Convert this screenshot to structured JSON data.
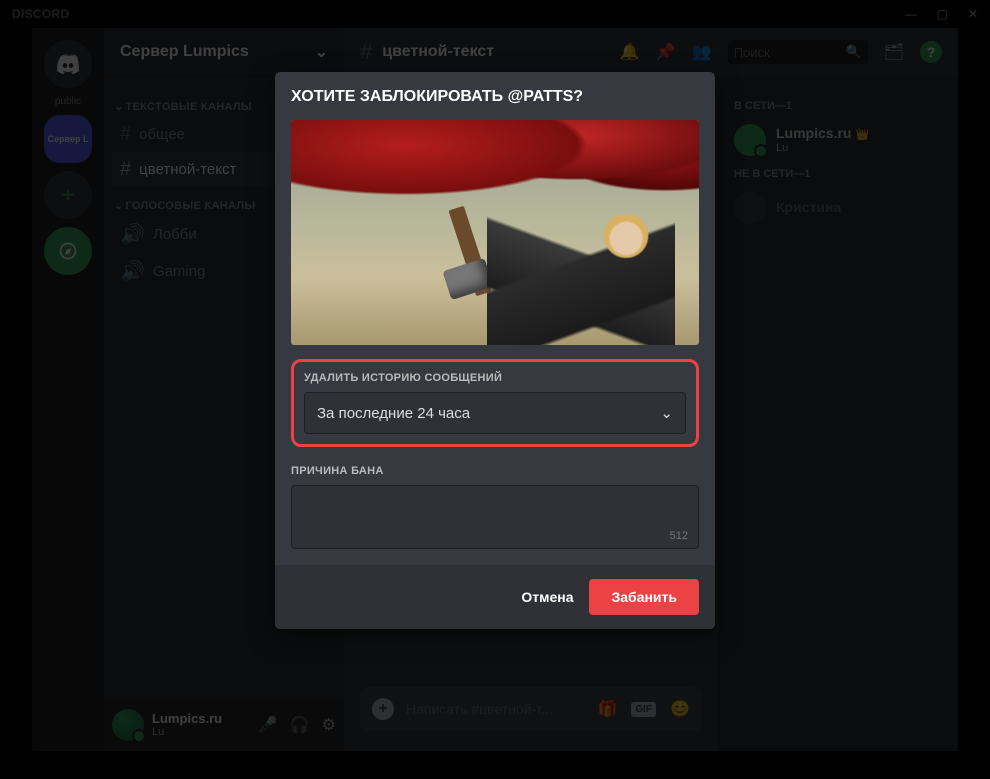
{
  "titlebar": {
    "logo": "DISCORD"
  },
  "servers": {
    "home_label": "public",
    "cepbep_label": "Сервер L"
  },
  "server_header": {
    "name": "Сервер Lumpics"
  },
  "channels": {
    "text_header": "ТЕКСТОВЫЕ КАНАЛЫ",
    "voice_header": "ГОЛОСОВЫЕ КАНАЛЫ",
    "general": "общее",
    "colored": "цветной-текст",
    "lobby": "Лобби",
    "gaming": "Gaming"
  },
  "user_panel": {
    "name": "Lumpics.ru",
    "sub": "Lu"
  },
  "header": {
    "channel": "цветной-текст"
  },
  "search": {
    "placeholder": "Поиск"
  },
  "input": {
    "placeholder": "Написать #цветной-т..."
  },
  "members": {
    "online_header": "В СЕТИ—1",
    "offline_header": "НЕ В СЕТИ—1",
    "m1_name": "Lumpics.ru",
    "m1_sub": "Lu",
    "m2_name": "Кристина"
  },
  "modal": {
    "title": "ХОТИТЕ ЗАБЛОКИРОВАТЬ @PATTS?",
    "delete_history_label": "УДАЛИТЬ ИСТОРИЮ СООБЩЕНИЙ",
    "dropdown_value": "За последние 24 часа",
    "reason_label": "ПРИЧИНА БАНА",
    "charcount": "512",
    "cancel": "Отмена",
    "ban": "Забанить"
  }
}
